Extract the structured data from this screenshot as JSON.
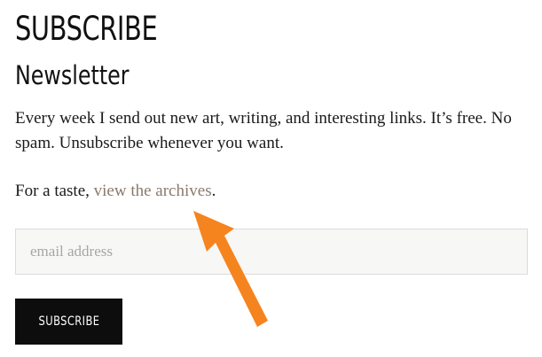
{
  "form": {
    "title": "SUBSCRIBE",
    "subtitle": "Newsletter",
    "intro_text": "Every week I send out new art, writing, and interesting links. It’s free. No spam. Unsubscribe whenever you want.",
    "taste_prefix": "For a taste, ",
    "archive_link_label": "view the archives",
    "taste_suffix": ".",
    "email_placeholder": "email address",
    "email_value": "",
    "submit_label": "SUBSCRIBE"
  },
  "annotation": {
    "arrow_color": "#f5841f",
    "arrow_icon": "arrow-pointer-icon"
  },
  "colors": {
    "text": "#111111",
    "link": "#8a7a6b",
    "button_bg": "#0d0d0d",
    "input_bg": "#f7f7f5"
  }
}
